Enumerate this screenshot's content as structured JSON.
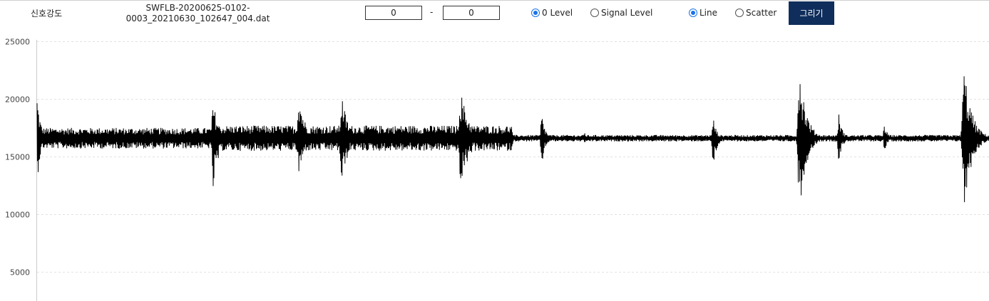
{
  "header": {
    "title": "신호강도",
    "file_name_line1": "SWFLB-20200625-0102-",
    "file_name_line2": "0003_20210630_102647_004.dat",
    "range_start": "0",
    "range_separator": "-",
    "range_end": "0",
    "level_options": [
      {
        "label": "0 Level",
        "checked": true
      },
      {
        "label": "Signal Level",
        "checked": false
      }
    ],
    "style_options": [
      {
        "label": "Line",
        "checked": true
      },
      {
        "label": "Scatter",
        "checked": false
      }
    ],
    "draw_button_label": "그리기",
    "accent_color": "#0f2e5c"
  },
  "chart_data": {
    "type": "line",
    "ylim": [
      2500,
      25000
    ],
    "yticks": [
      25000,
      20000,
      15000,
      10000,
      5000
    ],
    "grid": true,
    "grid_style": "dashed horizontal",
    "line_color": "#000000",
    "baseline": 16600,
    "x_range": [
      0,
      1
    ],
    "bursts": [
      {
        "x": 0.0,
        "peak_high": 20500,
        "peak_low": 12600,
        "width": 0.012
      },
      {
        "x": 0.185,
        "peak_high": 19800,
        "peak_low": 11900,
        "width": 0.02
      },
      {
        "x": 0.275,
        "peak_high": 20800,
        "peak_low": 13100,
        "width": 0.02
      },
      {
        "x": 0.32,
        "peak_high": 20600,
        "peak_low": 12200,
        "width": 0.02
      },
      {
        "x": 0.445,
        "peak_high": 20800,
        "peak_low": 12200,
        "width": 0.03
      },
      {
        "x": 0.53,
        "peak_high": 18900,
        "peak_low": 14000,
        "width": 0.012
      },
      {
        "x": 0.575,
        "peak_high": 17300,
        "peak_low": 15800,
        "width": 0.006
      },
      {
        "x": 0.71,
        "peak_high": 18600,
        "peak_low": 13700,
        "width": 0.012
      },
      {
        "x": 0.801,
        "peak_high": 23400,
        "peak_low": 10000,
        "width": 0.022
      },
      {
        "x": 0.842,
        "peak_high": 18900,
        "peak_low": 14300,
        "width": 0.012
      },
      {
        "x": 0.89,
        "peak_high": 18000,
        "peak_low": 15200,
        "width": 0.01
      },
      {
        "x": 0.974,
        "peak_high": 23000,
        "peak_low": 10300,
        "width": 0.025
      }
    ],
    "noise_segments": [
      {
        "x_start": 0.0,
        "x_end": 0.185,
        "amplitude": 900
      },
      {
        "x_start": 0.185,
        "x_end": 0.5,
        "amplitude": 1100
      },
      {
        "x_start": 0.5,
        "x_end": 1.0,
        "amplitude": 280
      }
    ]
  }
}
